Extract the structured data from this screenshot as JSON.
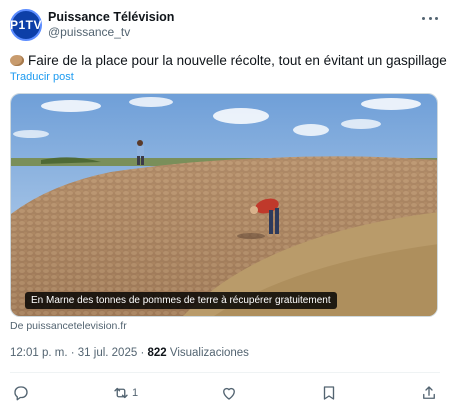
{
  "header": {
    "avatar_text": "P1TV",
    "display_name": "Puissance Télévision",
    "handle": "@puissance_tv",
    "more_icon": "more-horizontal-icon"
  },
  "tweet": {
    "emoji_icon": "potato-icon",
    "text": "Faire de la place pour la nouvelle récolte, tout en évitant un gaspillage",
    "translate_label": "Traducir post"
  },
  "media": {
    "caption": "En Marne des tonnes de pommes de terre à récupérer gratuitement"
  },
  "source": "De puissancetelevision.fr",
  "meta": {
    "time": "12:01 p. m.",
    "separator": " · ",
    "date": "31 jul. 2025",
    "views_count": "822",
    "views_label": "Visualizaciones"
  },
  "actions": {
    "reply_icon": "reply-icon",
    "repost_icon": "repost-icon",
    "repost_count": "1",
    "like_icon": "heart-icon",
    "bookmark_icon": "bookmark-icon",
    "share_icon": "share-icon"
  },
  "colors": {
    "accent": "#1d9bf0",
    "text": "#0f1419",
    "secondary": "#536471",
    "avatar_bg": "#0d3fa8"
  }
}
